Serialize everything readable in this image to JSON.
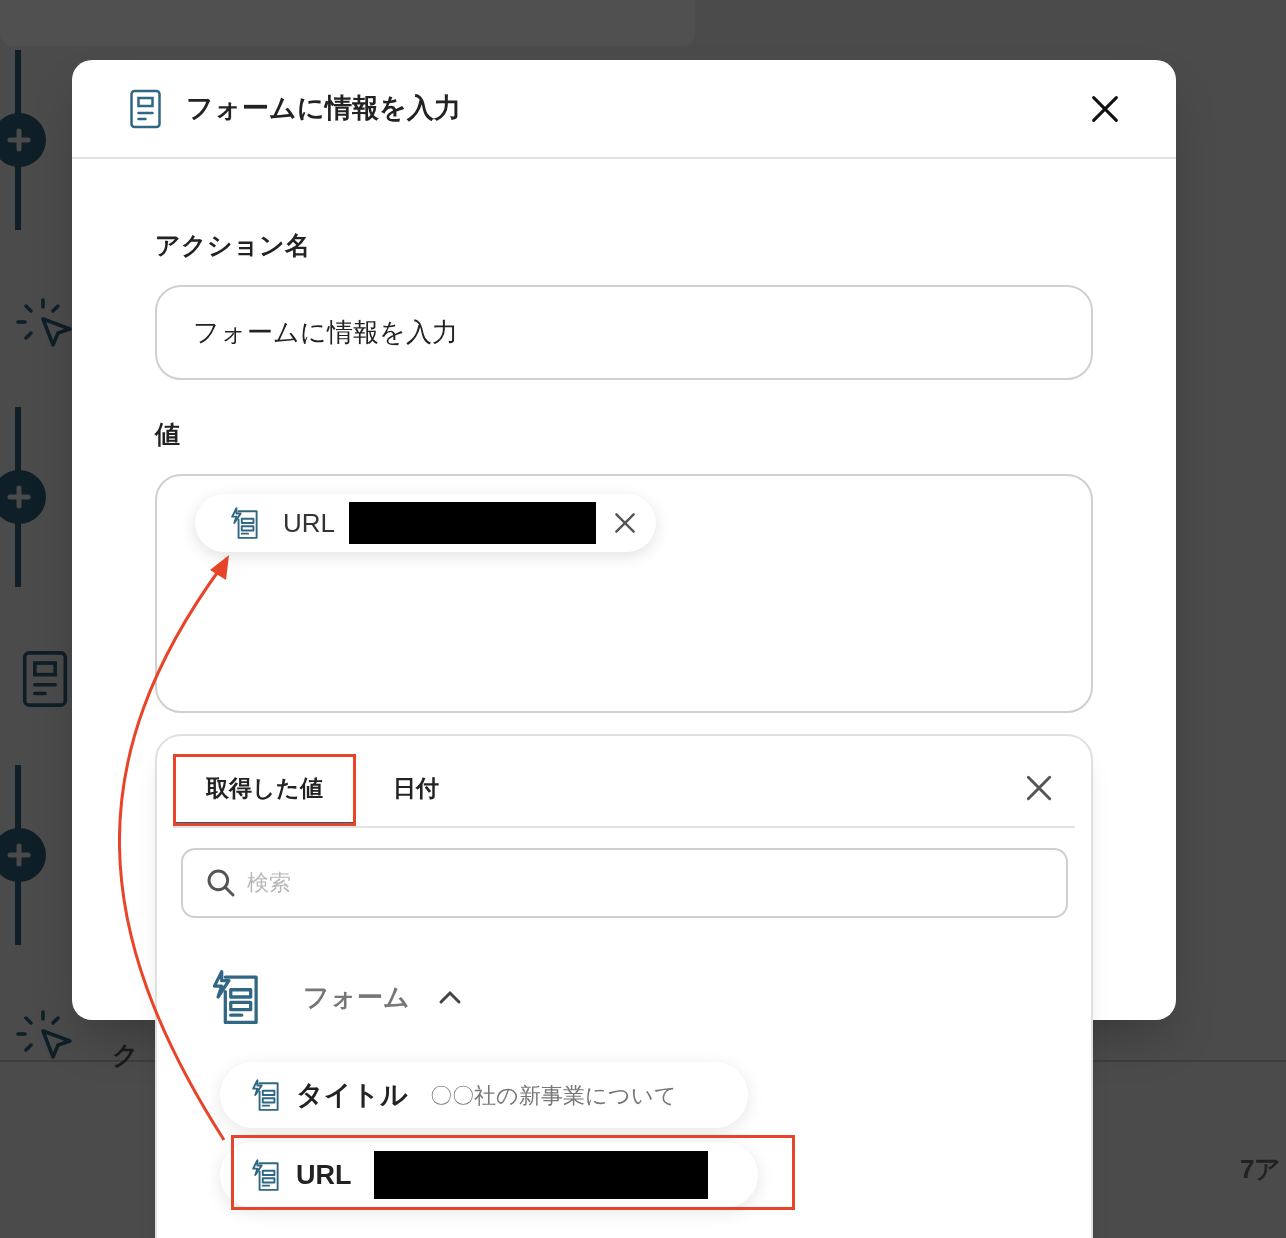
{
  "background": {
    "texts": [
      "ク",
      "7ア"
    ]
  },
  "modal": {
    "title": "フォームに情報を入力",
    "action_name": {
      "label": "アクション名",
      "value": "フォームに情報を入力"
    },
    "value_field": {
      "label": "値",
      "chips": [
        {
          "label": "URL",
          "redacted": true
        }
      ]
    }
  },
  "picker": {
    "tabs": [
      {
        "label": "取得した値",
        "selected": true,
        "highlighted": true
      },
      {
        "label": "日付",
        "selected": false,
        "highlighted": false
      }
    ],
    "search": {
      "placeholder": "検索"
    },
    "group": {
      "label": "フォーム",
      "expanded": true,
      "items": [
        {
          "label": "タイトル",
          "value": "〇〇社の新事業について",
          "redacted": false,
          "highlighted": false
        },
        {
          "label": "URL",
          "redacted": true,
          "highlighted": true
        }
      ]
    }
  }
}
